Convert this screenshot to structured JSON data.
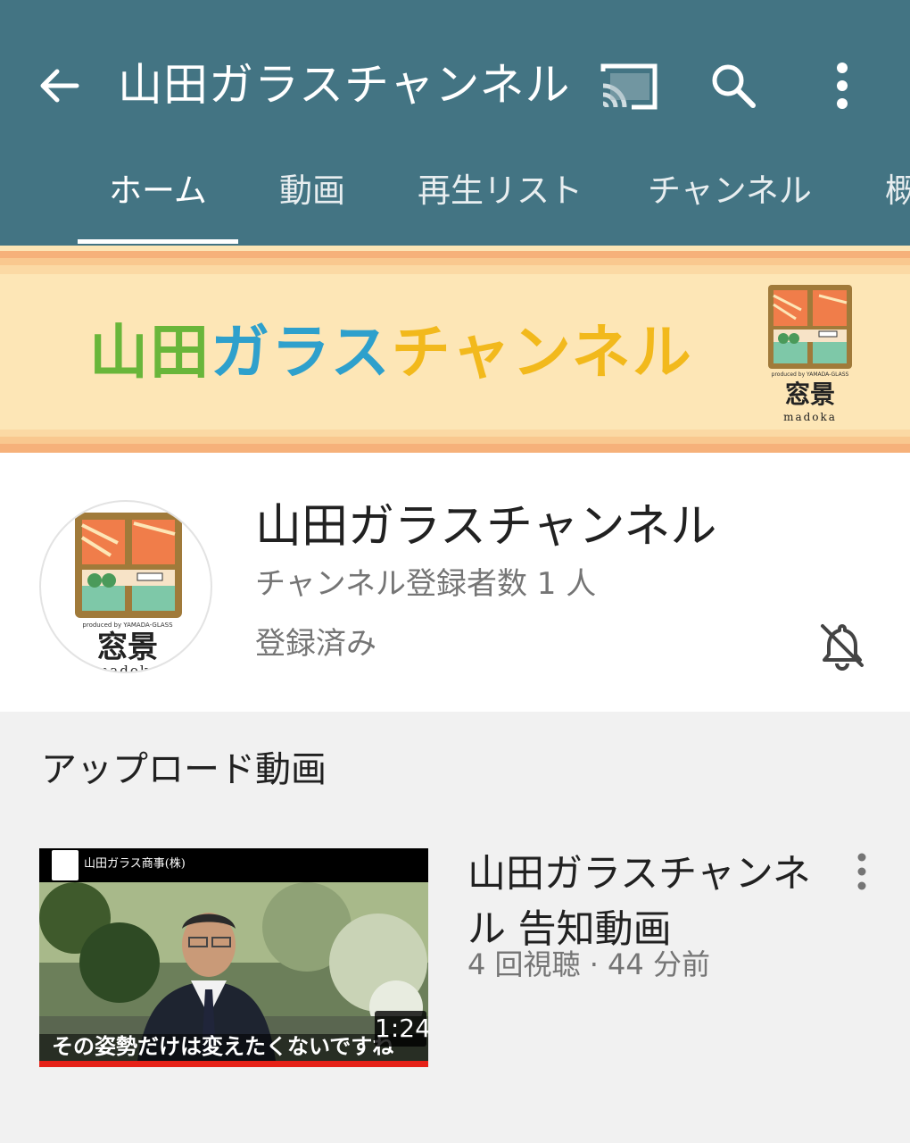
{
  "app_bar": {
    "title": "山田ガラスチャンネル",
    "icons": [
      "back-arrow-icon",
      "cast-icon",
      "search-icon",
      "more-vert-icon"
    ]
  },
  "tabs": [
    {
      "label": "ホーム",
      "active": true
    },
    {
      "label": "動画"
    },
    {
      "label": "再生リスト"
    },
    {
      "label": "チャンネル"
    },
    {
      "label": "概"
    }
  ],
  "banner": {
    "brand_part1": "山田",
    "brand_part2": "ガラス",
    "brand_part3": "チャンネル",
    "logo_caption": "produced by YAMADA-GLASS",
    "logo_name": "窓景",
    "logo_romaji": "madoka"
  },
  "channel": {
    "name": "山田ガラスチャンネル",
    "subscribers": "チャンネル登録者数 1 人",
    "subscribed_label": "登録済み",
    "avatar_caption": "produced by YAMADA-GLASS",
    "avatar_name": "窓景",
    "avatar_romaji": "madoka"
  },
  "uploads": {
    "section_title": "アップロード動画",
    "videos": [
      {
        "title": "山田ガラスチャンネル 告知動画",
        "meta": "4 回視聴 · 44 分前",
        "duration": "1:24",
        "thumb_header": "山田ガラス商事(株)",
        "thumb_caption": "その姿勢だけは変えたくないですね",
        "progress": 1.0
      }
    ]
  },
  "colors": {
    "app_bar": "#437483",
    "banner_bg": "#fde6b6",
    "progress_red": "#e62117"
  }
}
